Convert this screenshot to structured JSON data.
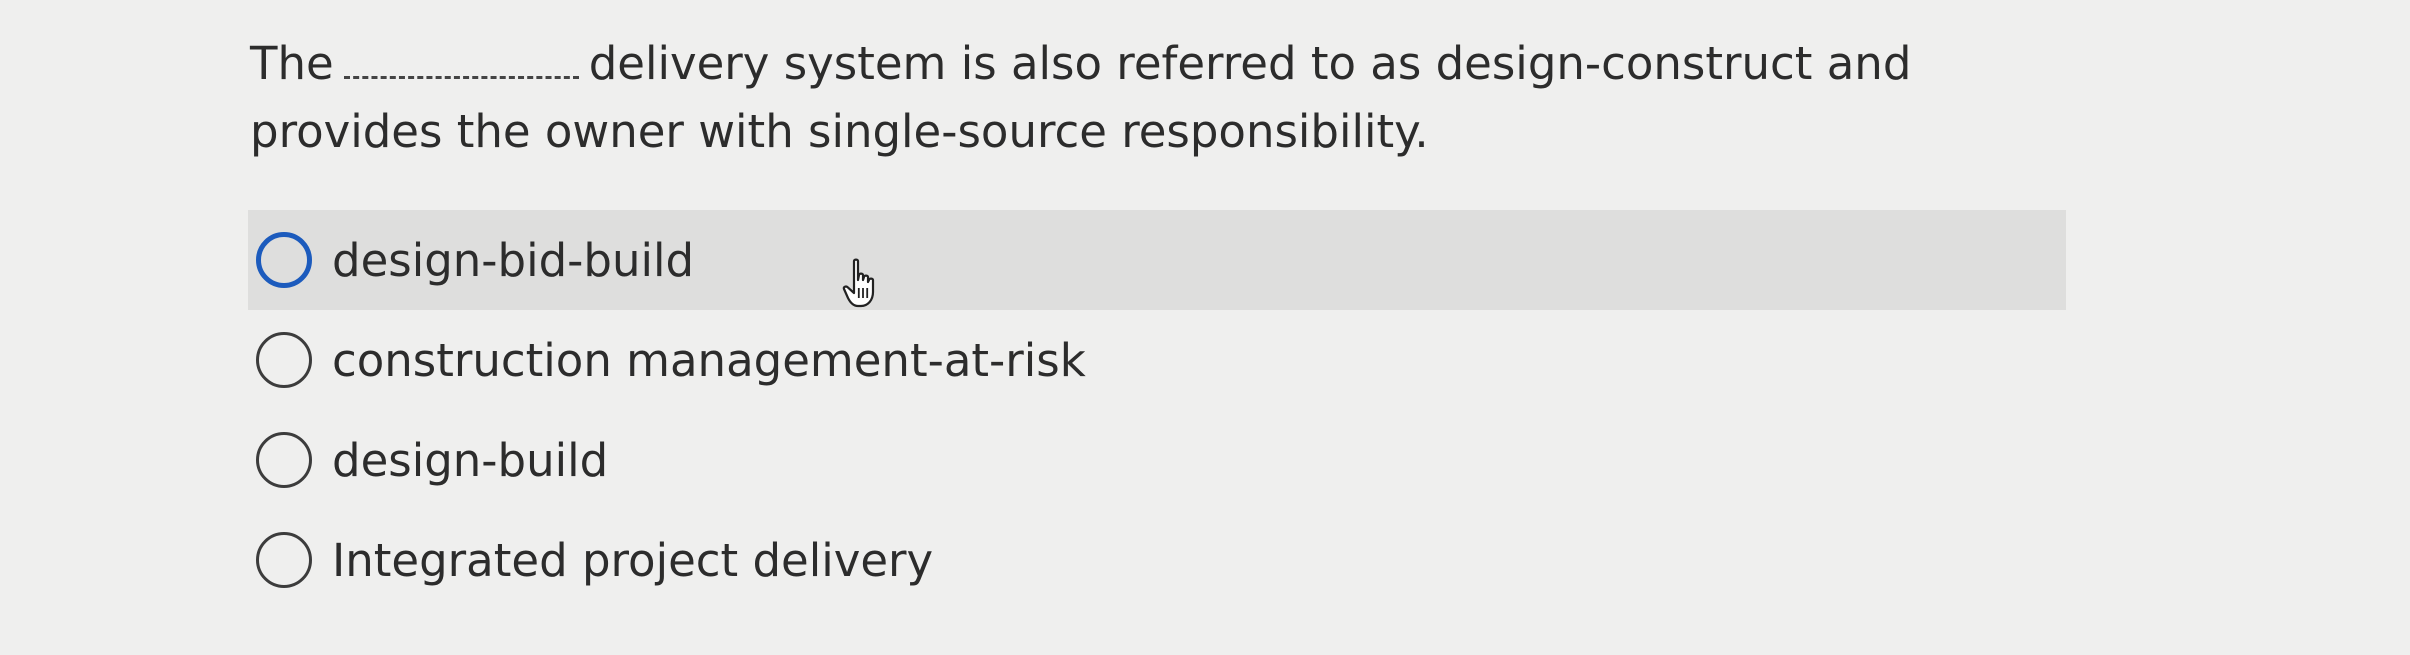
{
  "question": {
    "before_blank": "The",
    "after_blank": "delivery system is also referred to as design-construct and provides the owner with single-source responsibility."
  },
  "options": [
    {
      "label": "design-bid-build",
      "hovered": true
    },
    {
      "label": "construction management-at-risk",
      "hovered": false
    },
    {
      "label": "design-build",
      "hovered": false
    },
    {
      "label": "Integrated project delivery",
      "hovered": false
    }
  ],
  "colors": {
    "accent": "#1c5bbd",
    "hover_bg": "#dededd",
    "background": "#efefee"
  }
}
